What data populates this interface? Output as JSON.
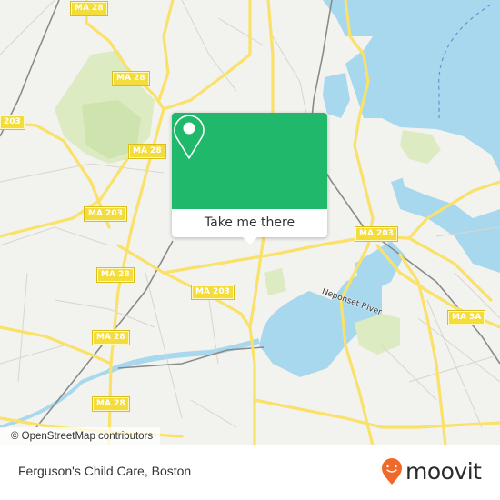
{
  "map": {
    "road_labels": [
      {
        "id": "ma28-top",
        "text": "MA 28"
      },
      {
        "id": "ma28-upper",
        "text": "MA 28"
      },
      {
        "id": "ma203-left",
        "text": "203"
      },
      {
        "id": "ma28-mid",
        "text": "MA 28"
      },
      {
        "id": "ma203-west",
        "text": "MA 203"
      },
      {
        "id": "ma28-lower1",
        "text": "MA 28"
      },
      {
        "id": "ma203-center",
        "text": "MA 203"
      },
      {
        "id": "ma28-lower2",
        "text": "MA 28"
      },
      {
        "id": "ma28-bottom",
        "text": "MA 28"
      },
      {
        "id": "ma203-east",
        "text": "MA 203"
      },
      {
        "id": "ma3a",
        "text": "MA 3A"
      }
    ],
    "water_label": "Neponset River",
    "colors": {
      "land": "#f2f2ee",
      "water": "#a8d8ee",
      "park": "#dcebc2",
      "road": "#f9e16a",
      "rail": "#888888"
    }
  },
  "popup": {
    "icon": "location-pin-icon",
    "button_label": "Take me there",
    "accent": "#20b86a"
  },
  "attribution": "© OpenStreetMap contributors",
  "footer": {
    "place_name": "Ferguson's Child Care, Boston",
    "logo_text": "moovit",
    "logo_color": "#f0692a"
  }
}
